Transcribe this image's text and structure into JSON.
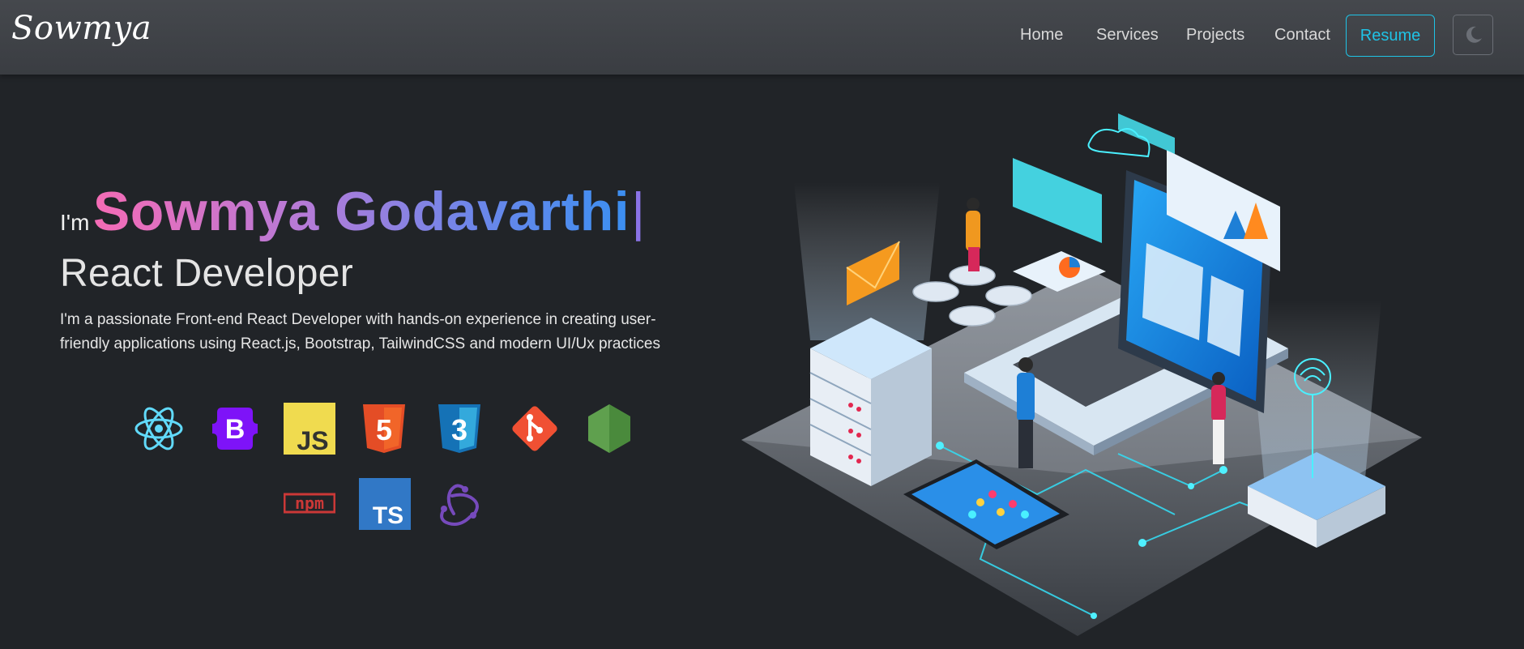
{
  "navbar": {
    "brand": "Sowmya",
    "links": [
      "Home",
      "Services",
      "Projects",
      "Contact"
    ],
    "resume_label": "Resume",
    "theme_toggle_icon": "moon-icon"
  },
  "hero": {
    "greeting_prefix": "I'm",
    "name": "Sowmya Godavarthi",
    "cursor": "|",
    "role": "React Developer",
    "description_line1": "I'm a passionate Front-end React Developer with hands-on experience in creating user-",
    "description_line2": "friendly applications using React.js, Bootstrap, TailwindCSS and modern UI/Ux practices",
    "skills": [
      "react-icon",
      "bootstrap-icon",
      "javascript-icon",
      "html5-icon",
      "css3-icon",
      "git-icon",
      "nodejs-icon",
      "npm-icon",
      "typescript-icon",
      "redux-icon"
    ],
    "js_label": "JS",
    "ts_label": "TS",
    "bootstrap_label": "B",
    "html_label": "5",
    "css_label": "3",
    "npm_label": "npm"
  },
  "colors": {
    "background": "#212428",
    "navbar": "#3f4247",
    "accent": "#1fc3e6",
    "name_gradient_start": "#f56bb5",
    "name_gradient_end": "#3b8ff1"
  }
}
